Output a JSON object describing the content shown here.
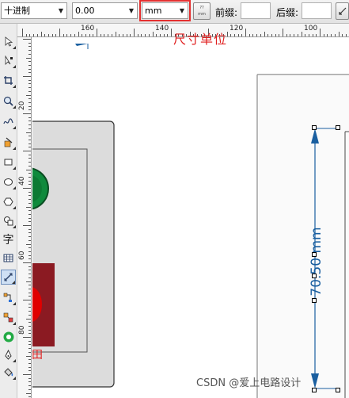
{
  "propbar": {
    "numbering": "十进制",
    "value": "0.00",
    "units": "mm",
    "dim_text_top": "??",
    "dim_text_bottom": "mm",
    "prefix_label": "前缀:",
    "suffix_label": "后缀:"
  },
  "annotation": "尺寸单位",
  "rulers": {
    "horizontal": [
      "160",
      "140",
      "120",
      "100"
    ],
    "vertical": [
      "20",
      "40",
      "60",
      "80"
    ],
    "corner": "⊹"
  },
  "canvas": {
    "dimension_label": "70.50 mm",
    "fragment_char": "田"
  },
  "watermark": "CSDN @爱上电路设计",
  "colors": {
    "highlight": "#e53030",
    "dimension": "#1a5fa0",
    "green_led": "#0f8a3c",
    "red_led": "#e00000",
    "dark_red": "#8b1a22",
    "panel_gray": "#dcdcdc"
  },
  "toolbox": [
    "pick-tool",
    "shape-tool",
    "crop-tool",
    "zoom-tool",
    "freehand-tool",
    "smart-fill-tool",
    "rectangle-tool",
    "ellipse-tool",
    "polygon-tool",
    "basic-shapes-tool",
    "text-tool",
    "table-tool",
    "dimension-tool",
    "connector-tool",
    "blend-tool",
    "eyedropper-tool",
    "outline-tool",
    "fill-tool"
  ]
}
